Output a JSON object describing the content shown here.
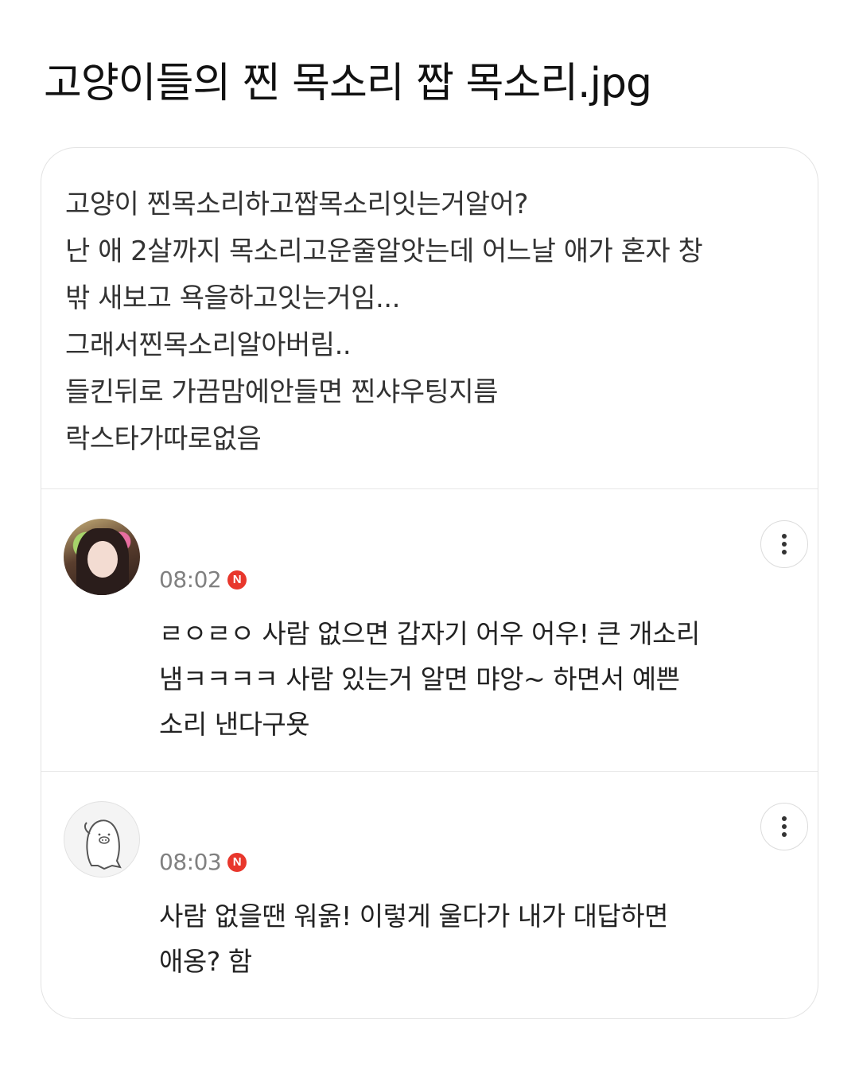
{
  "title": "고양이들의 찐 목소리 짭 목소리.jpg",
  "post": {
    "lines": [
      "고양이 찐목소리하고짭목소리잇는거알어?",
      "난 애 2살까지 목소리고운줄알앗는데 어느날 애가 혼자 창",
      "밖 새보고 욕을하고잇는거임...",
      "그래서찐목소리알아버림..",
      "들킨뒤로 가끔맘에안들면 찐샤우팅지름",
      "락스타가따로없음"
    ]
  },
  "comments": [
    {
      "time": "08:02",
      "badge": "N",
      "lines": [
        "ㄹㅇㄹㅇ 사람 없으면 갑자기 어우 어우! 큰 개소리",
        "냄ㅋㅋㅋㅋ 사람 있는거 알면 먀앙~ 하면서 예쁜",
        "소리 낸다구욧"
      ]
    },
    {
      "time": "08:03",
      "badge": "N",
      "lines": [
        "사람 없을땐 워옭! 이렇게 울다가 내가 대답하면",
        "애옹? 함"
      ]
    }
  ],
  "colors": {
    "badge": "#e8372c",
    "timestamp": "#808080",
    "border": "#e3e3e3"
  },
  "icons": {
    "more": "more-vertical-icon",
    "badge": "new-badge-icon"
  }
}
